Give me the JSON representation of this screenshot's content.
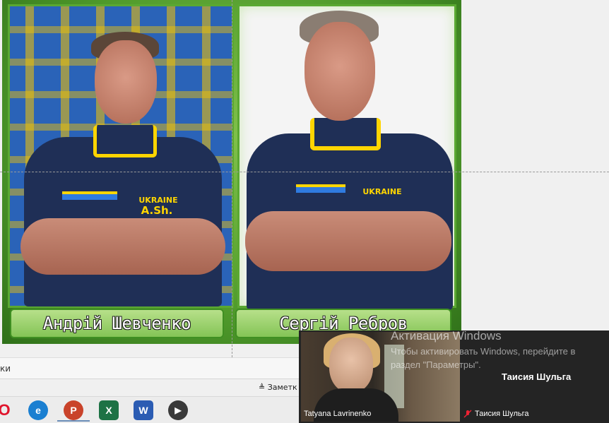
{
  "slide": {
    "left_caption": "Андрій Шевченко",
    "right_caption": "Сергій Ребров",
    "left_crest": "A.Sh.",
    "crest_label": "UKRAINE"
  },
  "notes": {
    "label": "ки",
    "status_notes": "Заметк"
  },
  "taskbar": {
    "apps": [
      {
        "name": "opera",
        "glyph": "O",
        "color": "#e0142c"
      },
      {
        "name": "edge",
        "glyph": "e",
        "color": "#1a7fd1"
      },
      {
        "name": "powerpoint",
        "glyph": "P",
        "color": "#c9432a"
      },
      {
        "name": "excel",
        "glyph": "X",
        "color": "#1d7245"
      },
      {
        "name": "word",
        "glyph": "W",
        "color": "#2b5cb3"
      },
      {
        "name": "media-player",
        "glyph": "▶",
        "color": "#3a3a3a"
      }
    ]
  },
  "video": {
    "participant_left": "Tatyana Lavrinenko",
    "participant_right": "Таисия Шульга",
    "participant_right_bottom": "Таисия Шульга"
  },
  "activation": {
    "title": "Активация Windows",
    "text": "Чтобы активировать Windows, перейдите в раздел \"Параметры\"."
  }
}
